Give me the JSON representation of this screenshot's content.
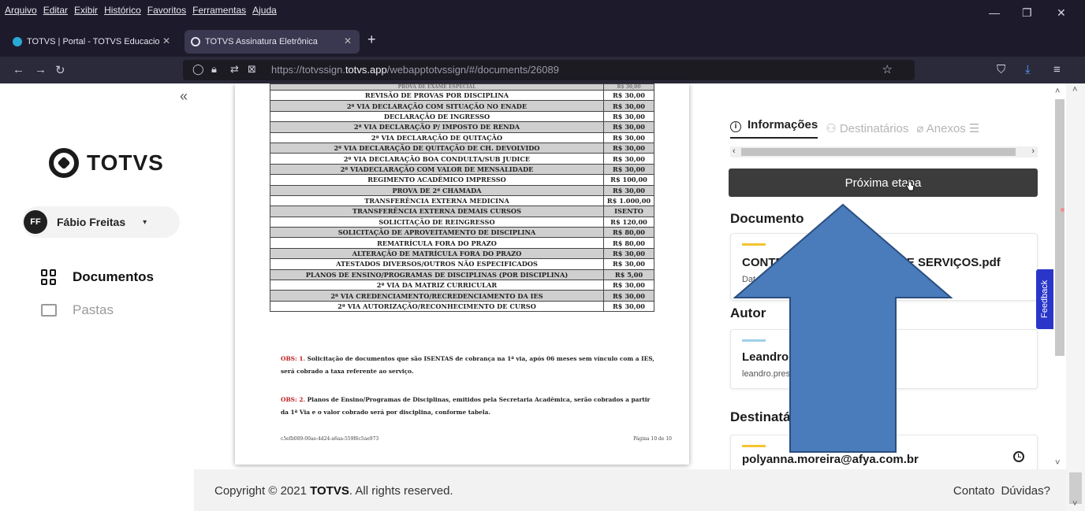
{
  "browser": {
    "menu": [
      "Arquivo",
      "Editar",
      "Exibir",
      "Histórico",
      "Favoritos",
      "Ferramentas",
      "Ajuda"
    ],
    "tabs": [
      {
        "title": "TOTVS | Portal - TOTVS Educacio"
      },
      {
        "title": "TOTVS Assinatura Eletrônica"
      }
    ],
    "url_prefix": "https://totvssign.",
    "url_domain": "totvs.app",
    "url_path": "/webapptotvssign/#/documents/26089"
  },
  "sidebar": {
    "collapse": "«",
    "logo": "TOTVS",
    "user": {
      "initials": "FF",
      "name": "Fábio Freitas"
    },
    "items": [
      {
        "label": "Documentos"
      },
      {
        "label": "Pastas"
      }
    ]
  },
  "document": {
    "cut_row": [
      "PROVA DE EXAME ESPECIAL",
      "R$ 30,00"
    ],
    "rows": [
      [
        "REVISÃO DE PROVAS POR DISCIPLINA",
        "R$ 30,00"
      ],
      [
        "2ª VIA DECLARAÇÃO COM SITUAÇÃO NO ENADE",
        "R$ 30,00"
      ],
      [
        "DECLARAÇÃO DE INGRESSO",
        "R$ 30,00"
      ],
      [
        "2ª VIA DECLARAÇÃO P/ IMPOSTO DE RENDA",
        "R$ 30,00"
      ],
      [
        "2ª VIA DECLARAÇÃO DE QUITAÇÃO",
        "R$ 30,00"
      ],
      [
        "2ª VIA DECLARAÇÃO DE QUITAÇÃO DE CH. DEVOLVIDO",
        "R$ 30,00"
      ],
      [
        "2ª VIA DECLARAÇÃO BOA CONDULTA/SUB JUDICE",
        "R$ 30,00"
      ],
      [
        "2ª VIADECLARAÇÃO COM VALOR DE MENSALIDADE",
        "R$ 30,00"
      ],
      [
        "REGIMENTO ACADÊMICO IMPRESSO",
        "R$ 100,00"
      ],
      [
        "PROVA DE 2ª CHAMADA",
        "R$ 30,00"
      ],
      [
        "TRANSFERÊNCIA EXTERNA MEDICINA",
        "R$ 1.000,00"
      ],
      [
        "TRANSFERÊNCIA EXTERNA DEMAIS CURSOS",
        "ISENTO"
      ],
      [
        "SOLICITAÇÃO DE REINGRESSO",
        "R$ 120,00"
      ],
      [
        "SOLICITAÇÃO DE APROVEITAMENTO DE DISCIPLINA",
        "R$ 80,00"
      ],
      [
        "REMATRÍCULA FORA DO PRAZO",
        "R$ 80,00"
      ],
      [
        "ALTERAÇÃO DE MATRÍCULA FORA DO PRAZO",
        "R$ 30,00"
      ],
      [
        "ATESTADOS DIVERSOS/OUTROS NÃO ESPECIFICADOS",
        "R$ 30,00"
      ],
      [
        "PLANOS DE ENSINO/PROGRAMAS DE DISCIPLINAS (POR DISCIPLINA)",
        "R$   5,00"
      ],
      [
        "2ª VIA DA MATRIZ CURRICULAR",
        "R$ 30,00"
      ],
      [
        "2ª VIA CREDENCIAMENTO/RECREDENCIAMENTO DA IES",
        "R$ 30,00"
      ],
      [
        "2ª VIA AUTORIZAÇÃO/RECONHECIMENTO DE CURSO",
        "R$ 30,00"
      ]
    ],
    "obs1_label": "OBS: 1.",
    "obs1_text": " Solicitação de documentos que são ISENTAS de cobrança na 1ª via, após 06 meses sem vínculo com a IES, será cobrado a taxa referente ao serviço.",
    "obs2_label": "OBS: 2.",
    "obs2_text": " Planos de Ensino/Programas de Disciplinas, emitidos pela Secretaria Acadêmica, serão cobrados a partir da 1ª Via e o valor cobrado será por disciplina, conforme tabela.",
    "footer_id": "c5efb089-00ae-4d24-a6aa-559f6c5ae973",
    "footer_page": "Página 10 de 10"
  },
  "panel": {
    "tabs": [
      "Informações",
      "Destinatários",
      "Anexos"
    ],
    "next_button": "Próxima etapa",
    "documento_heading": "Documento",
    "documento_title": "CONTR",
    "documento_title_end": "DE SERVIÇOS.pdf",
    "documento_sub": "Dat",
    "autor_heading": "Autor",
    "autor_name": "Leandro",
    "autor_email": "leandro.pres",
    "dest_heading": "Destinatá",
    "dest_email": "polyanna.moreira@afya.com.br",
    "feedback": "Feedback"
  },
  "footer": {
    "copyright_pre": "Copyright © 2021 ",
    "copyright_brand": "TOTVS",
    "copyright_post": ". All rights reserved.",
    "links": [
      "Contato",
      "Dúvidas?"
    ]
  },
  "colors": {
    "arrow_fill": "#4a7bbb",
    "arrow_stroke": "#2b4f80",
    "feedback_bg": "#2a36c9",
    "obs_red": "#c0201e",
    "card_accent_yellow": "#f4c430",
    "card_accent_blue": "#9ed0ea"
  }
}
